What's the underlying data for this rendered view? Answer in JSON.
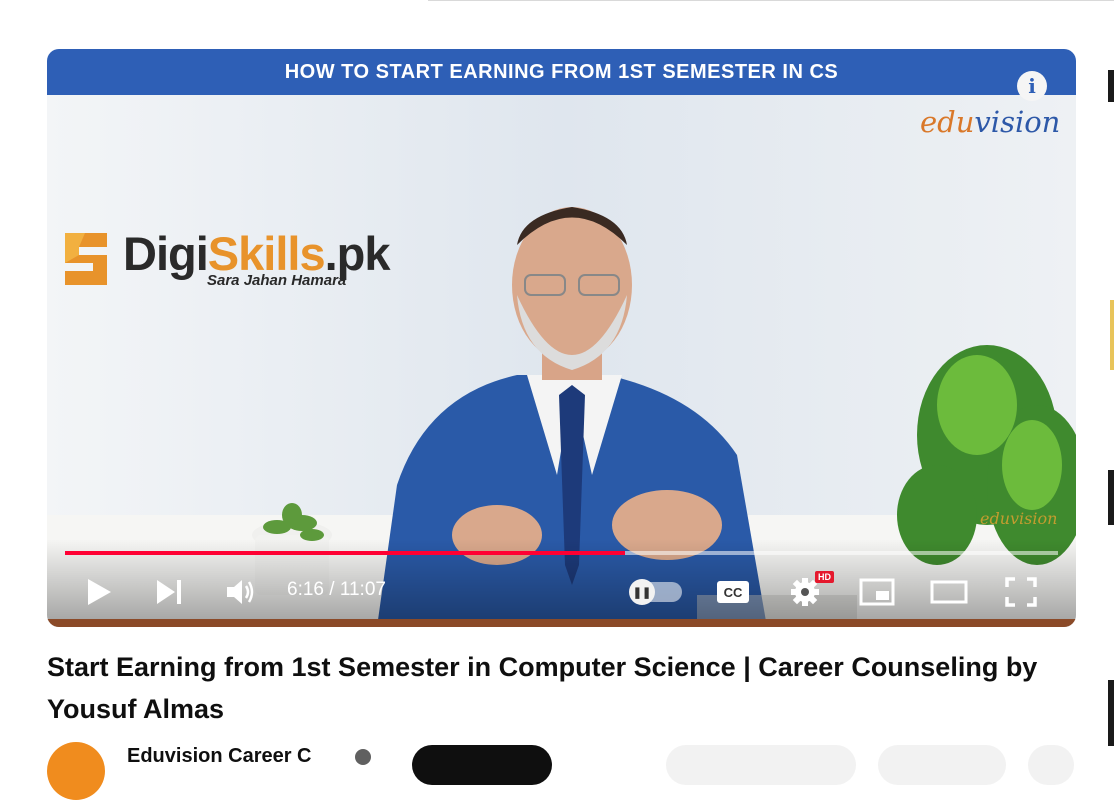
{
  "video": {
    "banner_text": "HOW TO START EARNING FROM 1ST SEMESTER IN CS",
    "edu_logo_part1": "edu",
    "edu_logo_part2": "vision",
    "watermark": "eduvision",
    "digiskills_name_1": "Digi",
    "digiskills_name_2": "Skills",
    "digiskills_name_3": ".pk",
    "digiskills_tagline": "Sara Jahan Hamara"
  },
  "player": {
    "current_time": "6:16",
    "duration": "11:07",
    "time_display": "6:16 / 11:07",
    "progress_fraction": 0.564,
    "hd_badge": "HD",
    "cc_label": "CC",
    "icons": [
      "play-icon",
      "next-icon",
      "volume-icon",
      "autoplay-toggle-icon",
      "cc-icon",
      "settings-icon",
      "miniplayer-icon",
      "theater-icon",
      "fullscreen-icon",
      "info-icon"
    ]
  },
  "title": "Start Earning from 1st Semester in Computer Science | Career Counseling by Yousuf Almas",
  "channel": {
    "name": "Eduvision Career C"
  },
  "colors": {
    "banner": "#2e5fb6",
    "progress": "#ff0033",
    "accent_orange": "#e8932b"
  }
}
